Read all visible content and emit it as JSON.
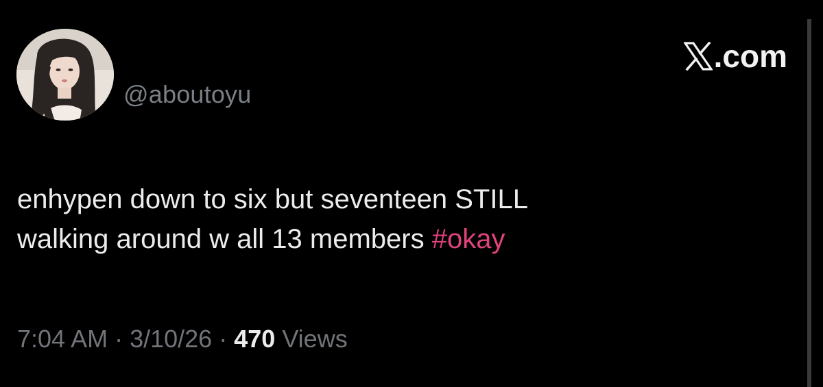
{
  "author": {
    "handle": "@aboutoyu",
    "avatar_icon": "profile-photo"
  },
  "brand": {
    "label": ".com",
    "icon": "x-logo-icon"
  },
  "tweet": {
    "line1": "enhypen down to six but seventeen STILL",
    "line2": "walking around w all 13 members ",
    "hashtag": "#okay"
  },
  "meta": {
    "time": "7:04 AM",
    "separator": "·",
    "date": "3/10/26",
    "views_count": "470",
    "views_label": "Views"
  },
  "colors": {
    "background": "#000000",
    "text": "#ececec",
    "muted": "#717478",
    "hashtag": "#e0427b"
  }
}
